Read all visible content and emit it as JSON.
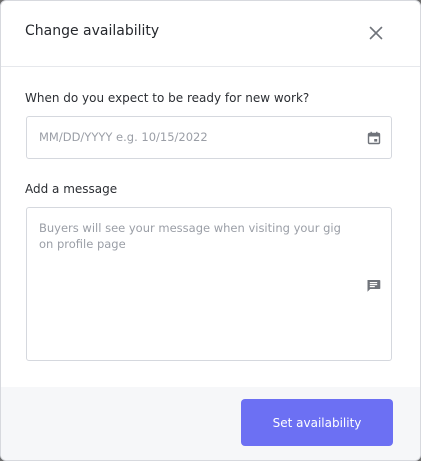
{
  "modal": {
    "title": "Change availability"
  },
  "date_field": {
    "label": "When do you expect to be ready for new work?",
    "placeholder": "MM/DD/YYYY e.g. 10/15/2022",
    "value": "",
    "icon": "calendar-icon"
  },
  "message_field": {
    "label": "Add a message",
    "placeholder": "Buyers will see your message when visiting your gig on profile page",
    "value": "",
    "icon": "message-icon"
  },
  "footer": {
    "submit_label": "Set availability"
  },
  "colors": {
    "accent": "#6c70f3",
    "footer_bg": "#f6f7f9",
    "border": "#d5d8de",
    "title_text": "#25282d",
    "placeholder_text": "#9a9ea6",
    "icon_gray": "#6f737a"
  },
  "icons": {
    "close": "close-icon",
    "calendar": "calendar-icon",
    "message": "message-icon"
  }
}
